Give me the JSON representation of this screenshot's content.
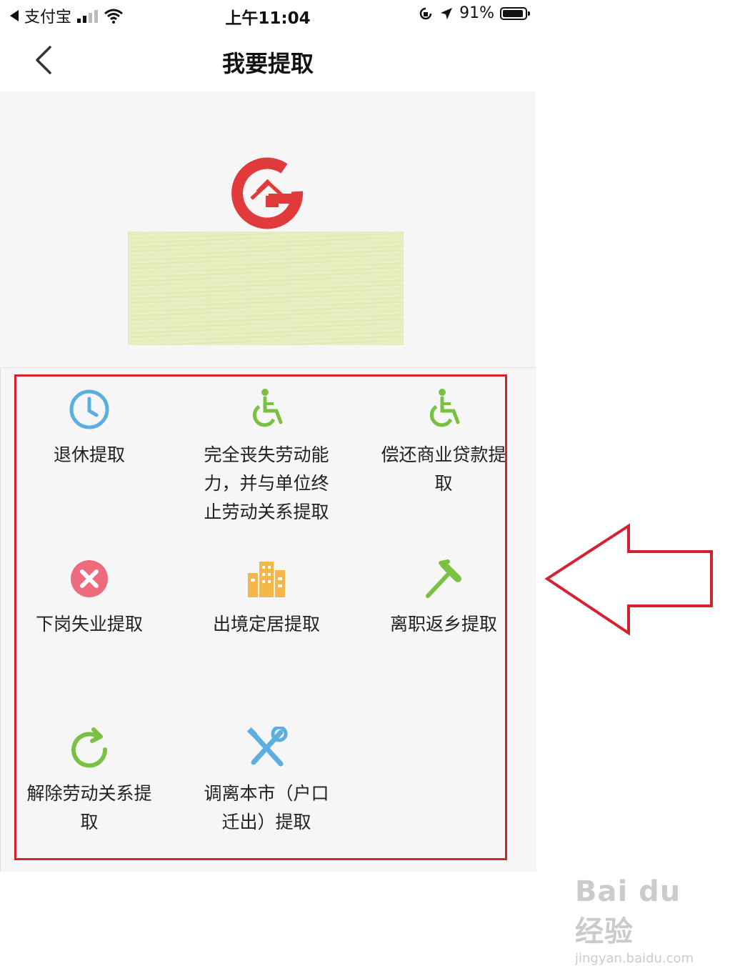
{
  "status_bar": {
    "carrier": "支付宝",
    "time": "上午11:04",
    "battery": "91%"
  },
  "nav": {
    "title": "我要提取"
  },
  "items": [
    {
      "label": "退休提取",
      "icon": "clock-icon",
      "color": "#5aaee0"
    },
    {
      "label": "完全丧失劳动能力，并与单位终止劳动关系提取",
      "icon": "wheelchair-icon",
      "color": "#7ac143"
    },
    {
      "label": "偿还商业贷款提取",
      "icon": "wheelchair-icon",
      "color": "#7ac143"
    },
    {
      "label": "下岗失业提取",
      "icon": "close-circle-icon",
      "color": "#ee6b7d"
    },
    {
      "label": "出境定居提取",
      "icon": "buildings-icon",
      "color": "#f5b64a"
    },
    {
      "label": "离职返乡提取",
      "icon": "hammer-icon",
      "color": "#7ac143"
    },
    {
      "label": "解除劳动关系提取",
      "icon": "refresh-icon",
      "color": "#7ac143"
    },
    {
      "label": "调离本市（户口迁出）提取",
      "icon": "tools-icon",
      "color": "#5aaee0"
    }
  ],
  "colors": {
    "annotation_red": "#d6222e",
    "logo_red": "#e03a3a"
  },
  "watermark": {
    "main": "Bai du 经验",
    "sub": "jingyan.baidu.com"
  }
}
